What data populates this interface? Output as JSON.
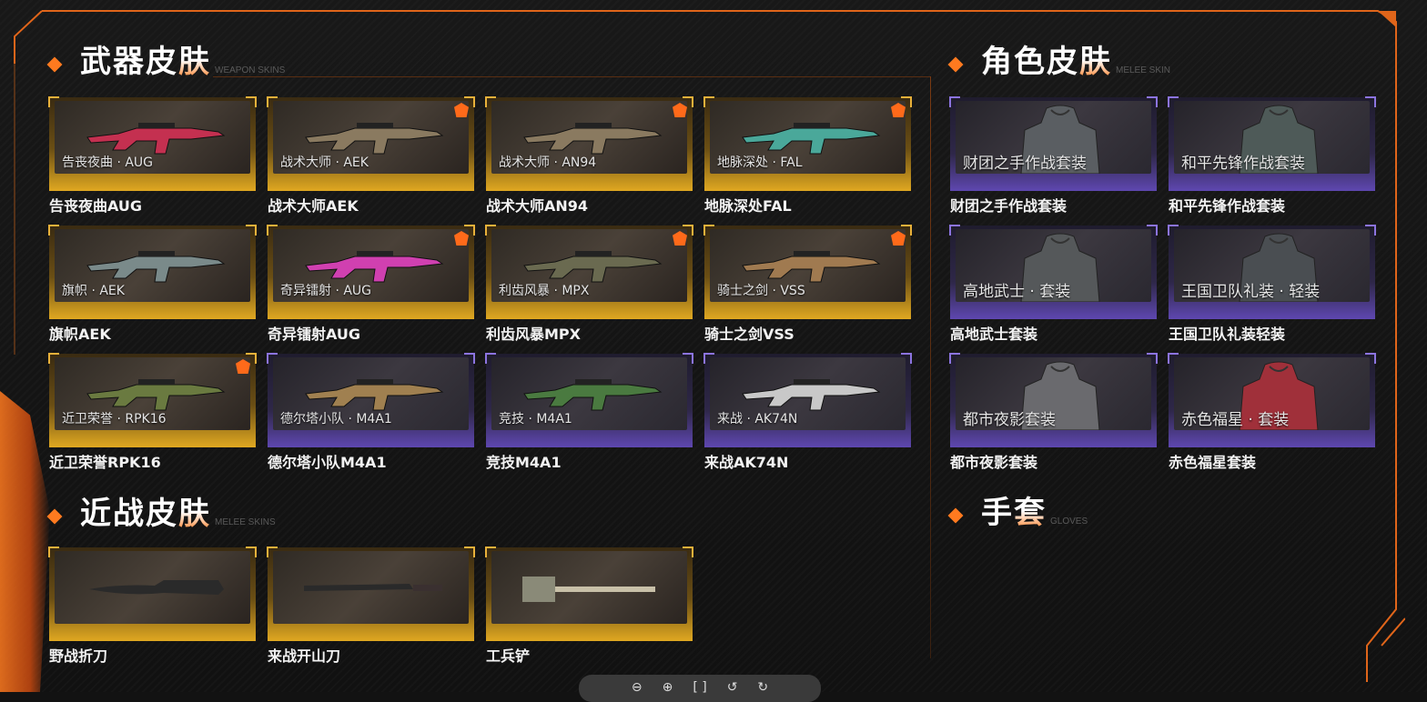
{
  "sections": {
    "weapon": {
      "title_main": "武器皮",
      "title_last": "肤",
      "subtitle": "WEAPON SKINS"
    },
    "role": {
      "title_main": "角色皮",
      "title_last": "肤",
      "subtitle": "MELEE SKIN"
    },
    "melee": {
      "title_main": "近战皮",
      "title_last": "肤",
      "subtitle": "MELEE SKINS"
    },
    "gloves": {
      "title_main": "手",
      "title_last": "套",
      "subtitle": "GLOVES"
    }
  },
  "weapon_skins": [
    {
      "overlay": "告丧夜曲 · AUG",
      "name": "告丧夜曲AUG",
      "rarity": "gold",
      "flag": false,
      "color": "#c43050"
    },
    {
      "overlay": "战术大师 · AEK",
      "name": "战术大师AEK",
      "rarity": "gold",
      "flag": true,
      "color": "#8a7a60"
    },
    {
      "overlay": "战术大师 · AN94",
      "name": "战术大师AN94",
      "rarity": "gold",
      "flag": true,
      "color": "#8a7a60"
    },
    {
      "overlay": "地脉深处 · FAL",
      "name": "地脉深处FAL",
      "rarity": "gold",
      "flag": true,
      "color": "#4aa89a"
    },
    {
      "overlay": "旗帜 · AEK",
      "name": "旗帜AEK",
      "rarity": "gold",
      "flag": false,
      "color": "#7a8a8a"
    },
    {
      "overlay": "奇异镭射 · AUG",
      "name": "奇异镭射AUG",
      "rarity": "gold",
      "flag": true,
      "color": "#d040b0"
    },
    {
      "overlay": "利齿风暴 · MPX",
      "name": "利齿风暴MPX",
      "rarity": "gold",
      "flag": true,
      "color": "#6a6a50"
    },
    {
      "overlay": "骑士之剑 · VSS",
      "name": "骑士之剑VSS",
      "rarity": "gold",
      "flag": true,
      "color": "#a07a50"
    },
    {
      "overlay": "近卫荣誉 · RPK16",
      "name": "近卫荣誉RPK16",
      "rarity": "gold",
      "flag": true,
      "color": "#6a7a40"
    },
    {
      "overlay": "德尔塔小队 · M4A1",
      "name": "德尔塔小队M4A1",
      "rarity": "purple",
      "flag": false,
      "color": "#a08050"
    },
    {
      "overlay": "竞技 · M4A1",
      "name": "竞技M4A1",
      "rarity": "purple",
      "flag": false,
      "color": "#4a7a40"
    },
    {
      "overlay": "来战 · AK74N",
      "name": "来战AK74N",
      "rarity": "purple",
      "flag": false,
      "color": "#c8c8c8"
    }
  ],
  "role_skins": [
    {
      "overlay": "财团之手作战套装",
      "name": "财团之手作战套装",
      "rarity": "purple",
      "color": "#5a5e62"
    },
    {
      "overlay": "和平先锋作战套装",
      "name": "和平先锋作战套装",
      "rarity": "purple",
      "color": "#4e5a58"
    },
    {
      "overlay": "高地武士 · 套装",
      "name": "高地武士套装",
      "rarity": "purple",
      "color": "#55585a"
    },
    {
      "overlay": "王国卫队礼装 · 轻装",
      "name": "王国卫队礼装轻装",
      "rarity": "purple",
      "color": "#4a4e52"
    },
    {
      "overlay": "都市夜影套装",
      "name": "都市夜影套装",
      "rarity": "purple",
      "color": "#6a6a6e"
    },
    {
      "overlay": "赤色福星 · 套装",
      "name": "赤色福星套装",
      "rarity": "purple",
      "color": "#a0303a"
    }
  ],
  "melee_skins": [
    {
      "name": "野战折刀",
      "rarity": "gold"
    },
    {
      "name": "来战开山刀",
      "rarity": "gold"
    },
    {
      "name": "工兵铲",
      "rarity": "gold"
    }
  ],
  "toolbar": {
    "icons": [
      "zoom-out-icon",
      "zoom-in-icon",
      "fit-icon",
      "rotate-left-icon",
      "rotate-right-icon"
    ]
  },
  "colors": {
    "accent": "#ff7a1f",
    "gold": "#e0a821",
    "purple": "#5e47b0"
  }
}
